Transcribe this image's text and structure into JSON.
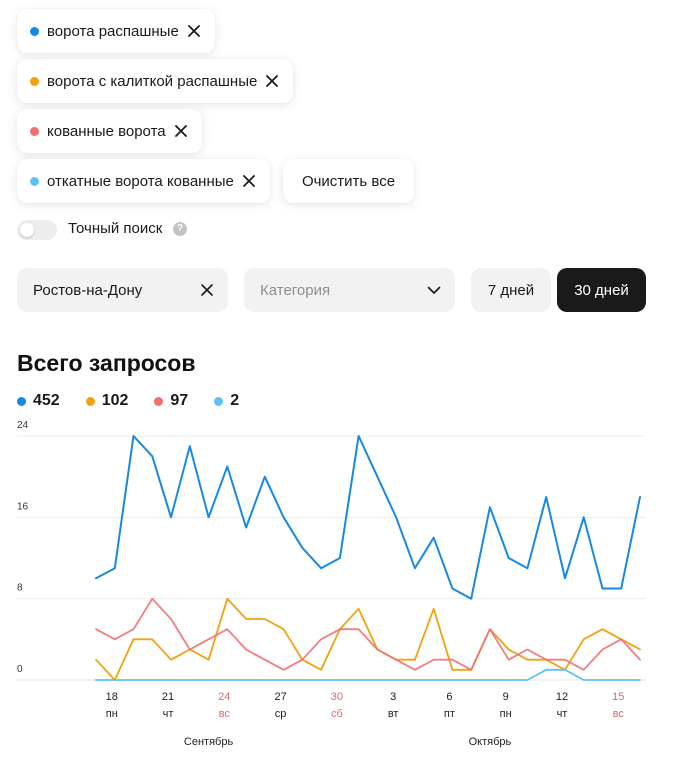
{
  "filters": {
    "chips": [
      {
        "label": "ворота распашные",
        "color": "#1789e0"
      },
      {
        "label": "ворота с калиткой распашные",
        "color": "#f2a10f"
      },
      {
        "label": "кованные ворота",
        "color": "#f07070"
      },
      {
        "label": "откатные ворота кованные",
        "color": "#5bc2f5"
      }
    ],
    "clear_all_label": "Очистить все"
  },
  "exact_search": {
    "label": "Точный поиск",
    "help": "?",
    "enabled": false
  },
  "city_select": {
    "value": "Ростов-на-Дону"
  },
  "category_select": {
    "placeholder": "Категория"
  },
  "period": {
    "days7_label": "7 дней",
    "days30_label": "30 дней",
    "selected": "30 дней"
  },
  "chart": {
    "title": "Всего запросов",
    "legend": [
      {
        "value": "452",
        "color": "#1789e0"
      },
      {
        "value": "102",
        "color": "#f2a10f"
      },
      {
        "value": "97",
        "color": "#f07070"
      },
      {
        "value": "2",
        "color": "#5bc2f5"
      }
    ]
  },
  "chart_data": {
    "type": "line",
    "title": "Всего запросов",
    "ylim": [
      0,
      24
    ],
    "yticks": [
      "0",
      "8",
      "16",
      "24"
    ],
    "grid": true,
    "x_labels": [
      {
        "index": 1,
        "day": "18",
        "weekday": "пн",
        "weekend": false
      },
      {
        "index": 4,
        "day": "21",
        "weekday": "чт",
        "weekend": false
      },
      {
        "index": 7,
        "day": "24",
        "weekday": "вс",
        "weekend": true
      },
      {
        "index": 10,
        "day": "27",
        "weekday": "ср",
        "weekend": false
      },
      {
        "index": 13,
        "day": "30",
        "weekday": "сб",
        "weekend": true
      },
      {
        "index": 16,
        "day": "3",
        "weekday": "вт",
        "weekend": false
      },
      {
        "index": 19,
        "day": "6",
        "weekday": "пт",
        "weekend": false
      },
      {
        "index": 22,
        "day": "9",
        "weekday": "пн",
        "weekend": false
      },
      {
        "index": 25,
        "day": "12",
        "weekday": "чт",
        "weekend": false
      },
      {
        "index": 28,
        "day": "15",
        "weekday": "вс",
        "weekend": true
      }
    ],
    "months": [
      {
        "label": "Сентябрь",
        "index": 6
      },
      {
        "label": "Октябрь",
        "index": 21
      }
    ],
    "series": [
      {
        "color": "#1789e0",
        "values": [
          10,
          11,
          24,
          22,
          16,
          23,
          16,
          21,
          15,
          20,
          16,
          13,
          11,
          12,
          24,
          20,
          16,
          11,
          14,
          9,
          8,
          17,
          12,
          11,
          18,
          10,
          16,
          9,
          9,
          18
        ]
      },
      {
        "color": "#f2a10f",
        "values": [
          2,
          0,
          4,
          4,
          2,
          3,
          2,
          8,
          6,
          6,
          5,
          2,
          1,
          5,
          7,
          3,
          2,
          2,
          7,
          1,
          1,
          5,
          3,
          2,
          2,
          1,
          4,
          5,
          4,
          3
        ]
      },
      {
        "color": "#f07070",
        "values": [
          5,
          4,
          5,
          8,
          6,
          3,
          4,
          5,
          3,
          2,
          1,
          2,
          4,
          5,
          5,
          3,
          2,
          1,
          2,
          2,
          1,
          5,
          2,
          3,
          2,
          2,
          1,
          3,
          4,
          2
        ]
      },
      {
        "color": "#5bc2f5",
        "values": [
          0,
          0,
          0,
          0,
          0,
          0,
          0,
          0,
          0,
          0,
          0,
          0,
          0,
          0,
          0,
          0,
          0,
          0,
          0,
          0,
          0,
          0,
          0,
          0,
          1,
          1,
          0,
          0,
          0,
          0
        ]
      }
    ]
  }
}
